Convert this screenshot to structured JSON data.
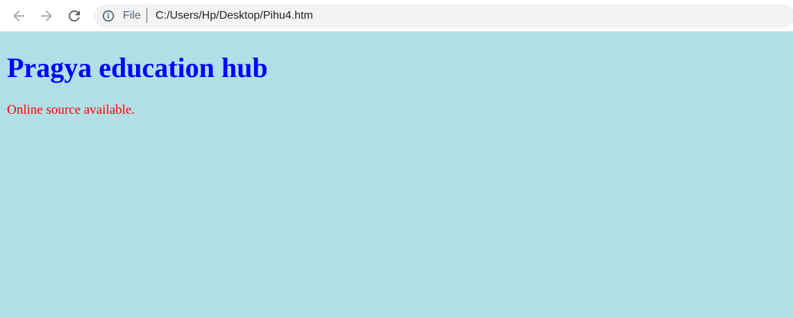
{
  "browser": {
    "scheme_label": "File",
    "address": "C:/Users/Hp/Desktop/Pihu4.htm"
  },
  "icons": {
    "back": "arrow-left-icon",
    "forward": "arrow-right-icon",
    "reload": "reload-icon",
    "site_info": "info-icon"
  },
  "page": {
    "heading": "Pragya education hub",
    "paragraph": "Online source available."
  },
  "colors": {
    "page_background": "#b0dfe5",
    "heading": "#0000ff",
    "paragraph": "#ff0000"
  }
}
